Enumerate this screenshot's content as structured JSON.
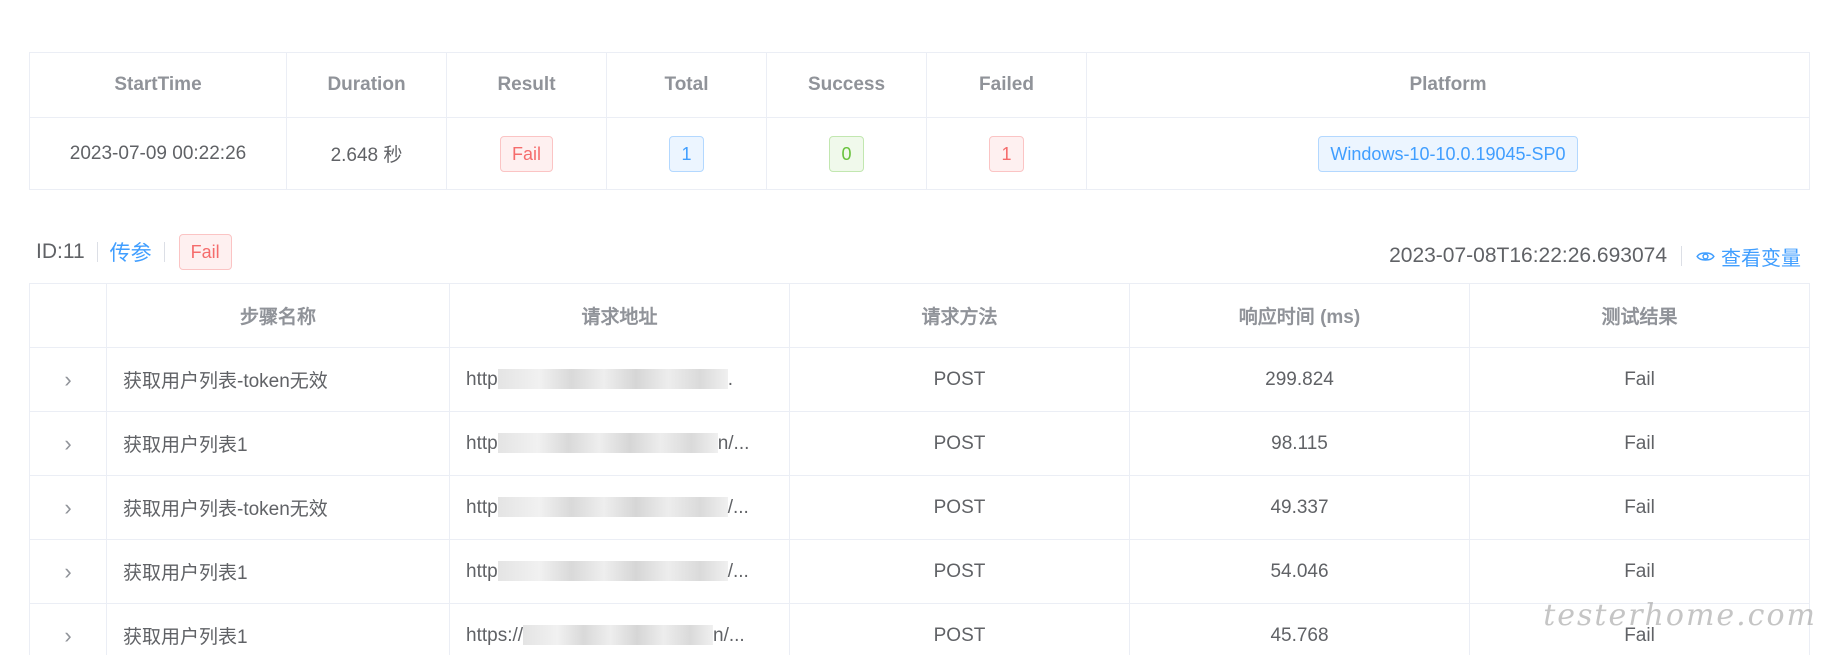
{
  "summary": {
    "headers": [
      "StartTime",
      "Duration",
      "Result",
      "Total",
      "Success",
      "Failed",
      "Platform"
    ],
    "start_time": "2023-07-09 00:22:26",
    "duration": "2.648 秒",
    "result": "Fail",
    "total": "1",
    "success": "0",
    "failed": "1",
    "platform": "Windows-10-10.0.19045-SP0"
  },
  "detail": {
    "id_label": "ID:11",
    "params_link": "传参",
    "status": "Fail",
    "timestamp": "2023-07-08T16:22:26.693074",
    "view_vars_label": "查看变量"
  },
  "steps": {
    "headers": [
      "",
      "步骤名称",
      "请求地址",
      "请求方法",
      "响应时间 (ms)",
      "测试结果"
    ],
    "rows": [
      {
        "name": "获取用户列表-token无效",
        "url_prefix": "http",
        "url_suffix": ".",
        "method": "POST",
        "time": "299.824",
        "result": "Fail"
      },
      {
        "name": "获取用户列表1",
        "url_prefix": "http",
        "url_suffix": "n/...",
        "method": "POST",
        "time": "98.115",
        "result": "Fail"
      },
      {
        "name": "获取用户列表-token无效",
        "url_prefix": "http",
        "url_suffix": "/...",
        "method": "POST",
        "time": "49.337",
        "result": "Fail"
      },
      {
        "name": "获取用户列表1",
        "url_prefix": "http",
        "url_suffix": "/...",
        "method": "POST",
        "time": "54.046",
        "result": "Fail"
      },
      {
        "name": "获取用户列表1",
        "url_prefix": "https://",
        "url_suffix": "n/...",
        "method": "POST",
        "time": "45.768",
        "result": "Fail"
      }
    ]
  },
  "watermark": "testerhome.com",
  "colors": {
    "primary": "#409eff",
    "danger": "#f56c6c",
    "success": "#67c23a"
  }
}
